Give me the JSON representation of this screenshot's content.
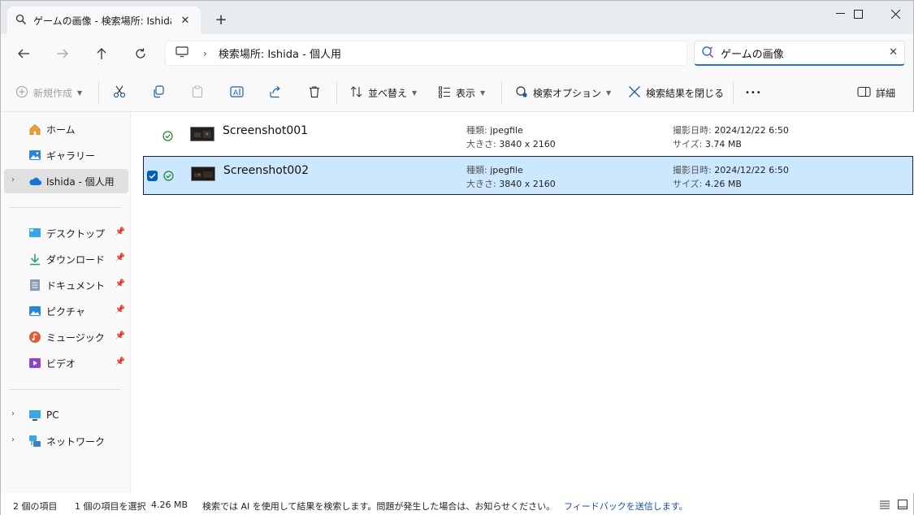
{
  "window": {
    "tab_title": "ゲームの画像 - 検索場所: Ishida - 個人用",
    "new_tab": "+",
    "controls": {
      "minimize": "—",
      "maximize": "☐",
      "close": "✕"
    }
  },
  "nav": {
    "back": "←",
    "forward": "→",
    "up": "↑",
    "refresh": "⟳",
    "breadcrumb_sep": "›",
    "breadcrumb": "検索場所: Ishida - 個人用",
    "search_value": "ゲームの画像",
    "search_clear": "✕"
  },
  "commands": {
    "new": "新規作成",
    "sort": "並べ替え",
    "view": "表示",
    "search_options": "検索オプション",
    "close_search": "検索結果を閉じる",
    "more": "•••",
    "details": "詳細"
  },
  "sidebar": {
    "top": [
      {
        "label": "ホーム",
        "icon": "home-icon"
      },
      {
        "label": "ギャラリー",
        "icon": "gallery-icon"
      },
      {
        "label": "Ishida - 個人用",
        "icon": "onedrive-icon"
      }
    ],
    "pinned": [
      {
        "label": "デスクトップ",
        "icon": "desktop-icon"
      },
      {
        "label": "ダウンロード",
        "icon": "download-icon"
      },
      {
        "label": "ドキュメント",
        "icon": "documents-icon"
      },
      {
        "label": "ピクチャ",
        "icon": "pictures-icon"
      },
      {
        "label": "ミュージック",
        "icon": "music-icon"
      },
      {
        "label": "ビデオ",
        "icon": "video-icon"
      }
    ],
    "bottom": [
      {
        "label": "PC",
        "icon": "pc-icon"
      },
      {
        "label": "ネットワーク",
        "icon": "network-icon"
      }
    ]
  },
  "files": [
    {
      "name": "Screenshot001",
      "type_label": "種類:",
      "type": "jpegfile",
      "size_dim_label": "大きさ:",
      "dimensions": "3840 x 2160",
      "date_label": "撮影日時:",
      "date": "2024/12/22 6:50",
      "filesize_label": "サイズ:",
      "filesize": "3.74 MB",
      "selected": false
    },
    {
      "name": "Screenshot002",
      "type_label": "種類:",
      "type": "jpegfile",
      "size_dim_label": "大きさ:",
      "dimensions": "3840 x 2160",
      "date_label": "撮影日時:",
      "date": "2024/12/22 6:50",
      "filesize_label": "サイズ:",
      "filesize": "4.26 MB",
      "selected": true
    }
  ],
  "status": {
    "count": "2 個の項目",
    "selection": "1 個の項目を選択",
    "selection_size": "4.26 MB",
    "notice": "検索では AI を使用して結果を検索します。問題が発生した場合は、お知らせください。",
    "feedback_link": "フィードバックを送信します。"
  },
  "colors": {
    "accent": "#005fb8",
    "selection_bg": "#cce8ff",
    "sync_green": "#1e7e34",
    "link": "#1a4fa3"
  }
}
